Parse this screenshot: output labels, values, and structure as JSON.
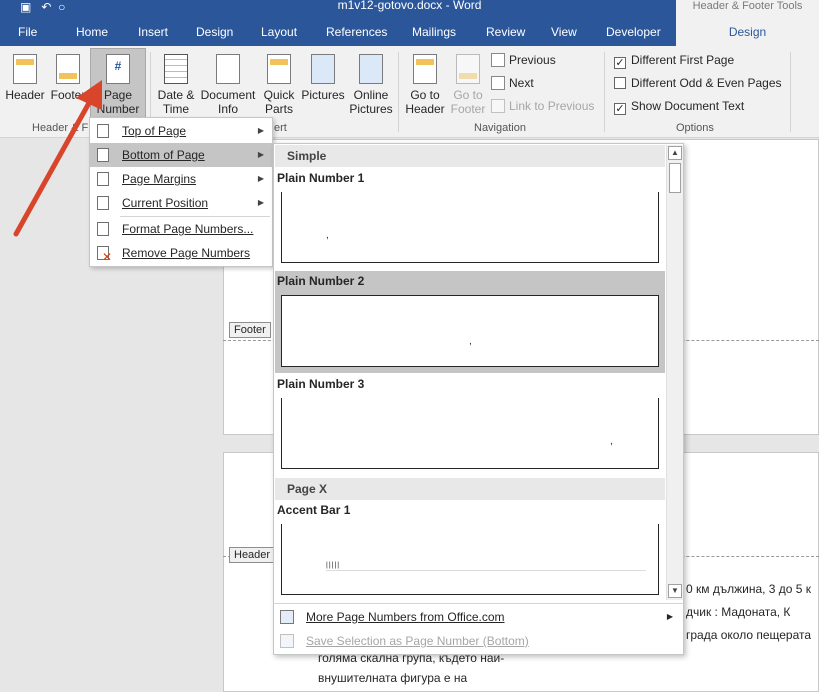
{
  "window": {
    "title": "m1v12-gotovo.docx - Word",
    "contextual_title": "Header & Footer Tools"
  },
  "tabs": [
    "File",
    "Home",
    "Insert",
    "Design",
    "Layout",
    "References",
    "Mailings",
    "Review",
    "View",
    "Developer"
  ],
  "active_tab": "Design",
  "ribbon": {
    "header": "Header",
    "footer": "Footer",
    "page_number_line1": "Page",
    "page_number_line2": "Number",
    "date_time_line1": "Date &",
    "date_time_line2": "Time",
    "doc_info_line1": "Document",
    "doc_info_line2": "Info",
    "quick_parts_line1": "Quick",
    "quick_parts_line2": "Parts",
    "pictures": "Pictures",
    "online_pictures_line1": "Online",
    "online_pictures_line2": "Pictures",
    "go_to_header_line1": "Go to",
    "go_to_header_line2": "Header",
    "go_to_footer_line1": "Go to",
    "go_to_footer_line2": "Footer",
    "previous": "Previous",
    "next": "Next",
    "link_to_previous": "Link to Previous",
    "group_header_footer": "Header & F",
    "group_insert": "ert",
    "group_navigation": "Navigation",
    "group_options": "Options",
    "opt_first_page": "Different First Page",
    "opt_odd_even": "Different Odd & Even Pages",
    "opt_show_text": "Show Document Text",
    "opt_first_page_checked": "✓",
    "opt_odd_even_checked": "",
    "opt_show_text_checked": "✓"
  },
  "page_number_menu": {
    "top_of_page": "Top of Page",
    "bottom_of_page": "Bottom of Page",
    "page_margins": "Page Margins",
    "current_position": "Current Position",
    "format_page_numbers": "Format Page Numbers...",
    "remove_page_numbers": "Remove Page Numbers"
  },
  "gallery": {
    "section_simple": "Simple",
    "plain1": "Plain Number 1",
    "plain2": "Plain Number 2",
    "plain3": "Plain Number 3",
    "section_page_x": "Page X",
    "accent1": "Accent Bar 1",
    "more": "More Page Numbers from Office.com",
    "save_selection": "Save Selection as Page Number (Bottom)",
    "preview_mark": ","
  },
  "document": {
    "footer_tag": "Footer",
    "header_tag": "Header",
    "line1": "0 км дължина, 3 до 5 к",
    "line2": "дчик : Мадоната, К",
    "line3": "града около пещерата",
    "line4": "голяма  скална  група,  където  най-",
    "line5": "внушителната    фигура    е    на"
  }
}
